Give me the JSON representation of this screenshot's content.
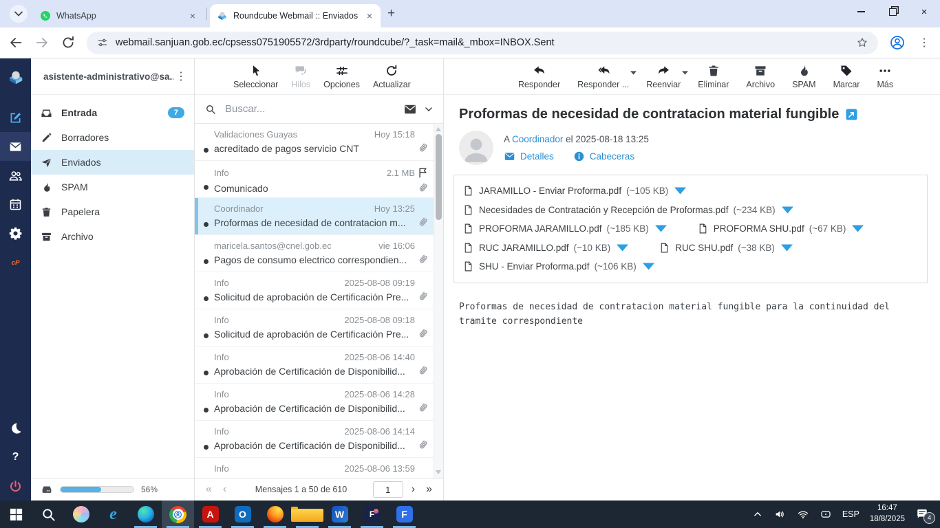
{
  "colors": {
    "accent": "#2a8fd4",
    "badge": "#3fa9e3",
    "selected_bg": "#d9edf9",
    "rail": "#1d2b4e",
    "caret_blue": "#2d9fe3",
    "quota_fill": "#56b2e8"
  },
  "browser": {
    "tabs": [
      {
        "label": "WhatsApp",
        "icon": "whatsapp"
      },
      {
        "label": "Roundcube Webmail :: Enviados",
        "icon": "roundcube"
      }
    ],
    "url": "webmail.sanjuan.gob.ec/cpsess0751905572/3rdparty/roundcube/?_task=mail&_mbox=INBOX.Sent"
  },
  "webmail": {
    "account": "asistente-administrativo@sa...",
    "folders": [
      {
        "label": "Entrada",
        "icon": "inbox",
        "badge": "7",
        "strong": true
      },
      {
        "label": "Borradores",
        "icon": "pencil"
      },
      {
        "label": "Enviados",
        "icon": "send",
        "selected": true
      },
      {
        "label": "SPAM",
        "icon": "flame"
      },
      {
        "label": "Papelera",
        "icon": "trash"
      },
      {
        "label": "Archivo",
        "icon": "archive"
      }
    ],
    "list_toolbar": [
      {
        "label": "Seleccionar",
        "key": "select",
        "icon": "cursor"
      },
      {
        "label": "Hilos",
        "key": "threads",
        "icon": "threads",
        "disabled": true
      },
      {
        "label": "Opciones",
        "key": "options",
        "icon": "options"
      },
      {
        "label": "Actualizar",
        "key": "refresh",
        "icon": "refresh"
      }
    ],
    "search_placeholder": "Buscar...",
    "messages": [
      {
        "sender": "Validaciones Guayas",
        "meta": "Hoy 15:18",
        "subject": "acreditado de pagos servicio CNT",
        "attach": true
      },
      {
        "sender": "Info",
        "meta": "2.1 MB",
        "flagged": true,
        "subject": "Comunicado",
        "attach": true
      },
      {
        "sender": "Coordinador",
        "meta": "Hoy 13:25",
        "subject": "Proformas de necesidad de contratacion m...",
        "attach": true,
        "selected": true
      },
      {
        "sender": "maricela.santos@cnel.gob.ec",
        "meta": "vie 16:06",
        "subject": "Pagos de consumo electrico correspondien...",
        "attach": true
      },
      {
        "sender": "Info",
        "meta": "2025-08-08 09:19",
        "subject": "Solicitud de aprobación de Certificación Pre...",
        "attach": true
      },
      {
        "sender": "Info",
        "meta": "2025-08-08 09:18",
        "subject": "Solicitud de aprobación de Certificación Pre...",
        "attach": true
      },
      {
        "sender": "Info",
        "meta": "2025-08-06 14:40",
        "subject": "Aprobación de Certificación de Disponibilid...",
        "attach": true
      },
      {
        "sender": "Info",
        "meta": "2025-08-06 14:28",
        "subject": "Aprobación de Certificación de Disponibilid...",
        "attach": true
      },
      {
        "sender": "Info",
        "meta": "2025-08-06 14:14",
        "subject": "Aprobación de Certificación de Disponibilid...",
        "attach": true
      },
      {
        "sender": "Info",
        "meta": "2025-08-06 13:59",
        "subject": "",
        "attach": false,
        "partial": true
      }
    ],
    "pagination": {
      "summary": "Mensajes 1 a 50 de 610",
      "page": "1"
    },
    "quota": {
      "percent": "56%",
      "fill": 56
    }
  },
  "reader": {
    "toolbar": [
      {
        "label": "Responder",
        "key": "reply",
        "icon": "reply"
      },
      {
        "label": "Responder ...",
        "key": "reply-all",
        "icon": "reply-all",
        "caret": true
      },
      {
        "label": "Reenviar",
        "key": "forward",
        "icon": "forward",
        "caret": true
      },
      {
        "label": "Eliminar",
        "key": "delete",
        "icon": "trash"
      },
      {
        "label": "Archivo",
        "key": "archive",
        "icon": "archive"
      },
      {
        "label": "SPAM",
        "key": "junk",
        "icon": "flame"
      },
      {
        "label": "Marcar",
        "key": "mark",
        "icon": "tag"
      },
      {
        "label": "Más",
        "key": "more",
        "icon": "more"
      }
    ],
    "subject": "Proformas de necesidad de contratacion material fungible",
    "meta": {
      "prefix": "A",
      "to": "Coordinador",
      "rest": "el 2025-08-18 13:25"
    },
    "actions": [
      {
        "label": "Detalles",
        "icon": "env-blue"
      },
      {
        "label": "Cabeceras",
        "icon": "info-blue"
      }
    ],
    "attachment_rows": [
      [
        {
          "name": "JARAMILLO - Enviar Proforma.pdf",
          "size": "(~105 KB)"
        }
      ],
      [
        {
          "name": "Necesidades de Contratación y Recepción de Proformas.pdf",
          "size": "(~234 KB)"
        }
      ],
      [
        {
          "name": "PROFORMA JARAMILLO.pdf",
          "size": "(~185 KB)"
        },
        {
          "name": "PROFORMA SHU.pdf",
          "size": "(~67 KB)"
        }
      ],
      [
        {
          "name": "RUC JARAMILLO.pdf",
          "size": "(~10 KB)"
        },
        {
          "name": "RUC SHU.pdf",
          "size": "(~38 KB)"
        }
      ],
      [
        {
          "name": "SHU - Enviar Proforma.pdf",
          "size": "(~106 KB)"
        }
      ]
    ],
    "body": "Proformas de necesidad de contratacion material fungible para la continuidad del tramite correspondiente"
  },
  "taskbar": {
    "apps": [
      {
        "name": "start",
        "label": "start"
      },
      {
        "name": "search",
        "label": "search"
      },
      {
        "name": "copilot",
        "label": "copilot"
      },
      {
        "name": "internet-explorer",
        "label": "e"
      },
      {
        "name": "edge",
        "label": "edge",
        "run": true
      },
      {
        "name": "chrome",
        "label": "chrome",
        "run": true,
        "active": true
      },
      {
        "name": "acrobat",
        "label": "A",
        "run": true
      },
      {
        "name": "outlook",
        "label": "O",
        "run": true
      },
      {
        "name": "firefox",
        "label": "firefox",
        "run": true
      },
      {
        "name": "file-explorer",
        "label": "explorer",
        "run": true
      },
      {
        "name": "word",
        "label": "W",
        "run": true
      },
      {
        "name": "firma-ec",
        "label": "F",
        "run": true
      },
      {
        "name": "blue-f-app",
        "label": "F",
        "run": true
      }
    ],
    "tray": {
      "lang": "ESP",
      "time": "16:47",
      "date": "18/8/2025",
      "notif_count": "4"
    }
  }
}
